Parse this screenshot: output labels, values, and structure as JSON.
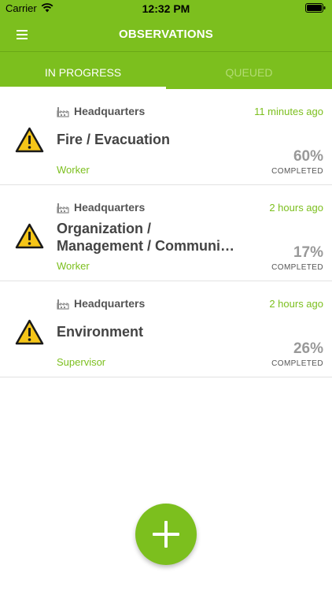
{
  "status_bar": {
    "carrier": "Carrier",
    "time": "12:32 PM"
  },
  "nav": {
    "title": "OBSERVATIONS"
  },
  "tabs": [
    {
      "label": "IN PROGRESS",
      "active": true
    },
    {
      "label": "QUEUED",
      "active": false
    }
  ],
  "observations": [
    {
      "site": "Headquarters",
      "time": "11 minutes ago",
      "title": "Fire / Evacuation",
      "role": "Worker",
      "progress": "60%",
      "progress_label": "COMPLETED"
    },
    {
      "site": "Headquarters",
      "time": "2 hours ago",
      "title_line1": "Organization /",
      "title_line2": "Management / Communi…",
      "role": "Worker",
      "progress": "17%",
      "progress_label": "COMPLETED"
    },
    {
      "site": "Headquarters",
      "time": "2 hours ago",
      "title": "Environment",
      "role": "Supervisor",
      "progress": "26%",
      "progress_label": "COMPLETED"
    }
  ],
  "icons": {
    "menu": "menu-icon",
    "site": "factory-icon",
    "alert": "warning-icon",
    "add": "plus-icon"
  },
  "colors": {
    "accent": "#7cbf1e",
    "warning": "#f5c518",
    "text": "#444444",
    "muted": "#999999"
  }
}
